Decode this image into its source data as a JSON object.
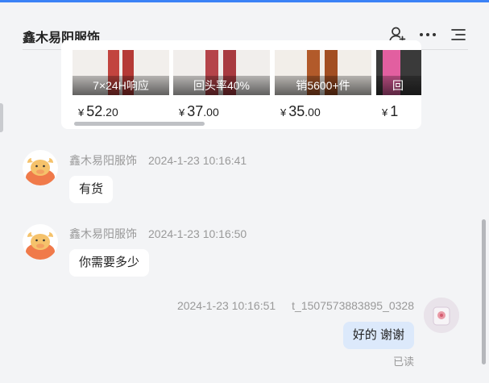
{
  "header": {
    "title": "鑫木易阳服饰"
  },
  "products": [
    {
      "tag": "7×24H响应",
      "yen": "¥",
      "price_int": "52",
      "price_dec": ".20",
      "color": "#c2443f"
    },
    {
      "tag": "回头率40%",
      "yen": "¥",
      "price_int": "37",
      "price_dec": ".00",
      "color": "#b5444a"
    },
    {
      "tag": "销5600+件",
      "yen": "¥",
      "price_int": "35",
      "price_dec": ".00",
      "color": "#b25a2a"
    },
    {
      "tag": "回",
      "yen": "¥",
      "price_int": "1",
      "price_dec": "",
      "color": "#e25fa0"
    }
  ],
  "messages": [
    {
      "sender": "鑫木易阳服饰",
      "time": "2024-1-23 10:16:41",
      "text": "有货"
    },
    {
      "sender": "鑫木易阳服饰",
      "time": "2024-1-23 10:16:50",
      "text": "你需要多少"
    },
    {
      "sender": "t_1507573883895_0328",
      "time": "2024-1-23 10:16:51",
      "text": "好的  谢谢",
      "status": "已读"
    }
  ],
  "colors": {
    "accent": "#3b82f6",
    "mine_bubble": "#dce9fb",
    "bull": "#f07a4a"
  }
}
